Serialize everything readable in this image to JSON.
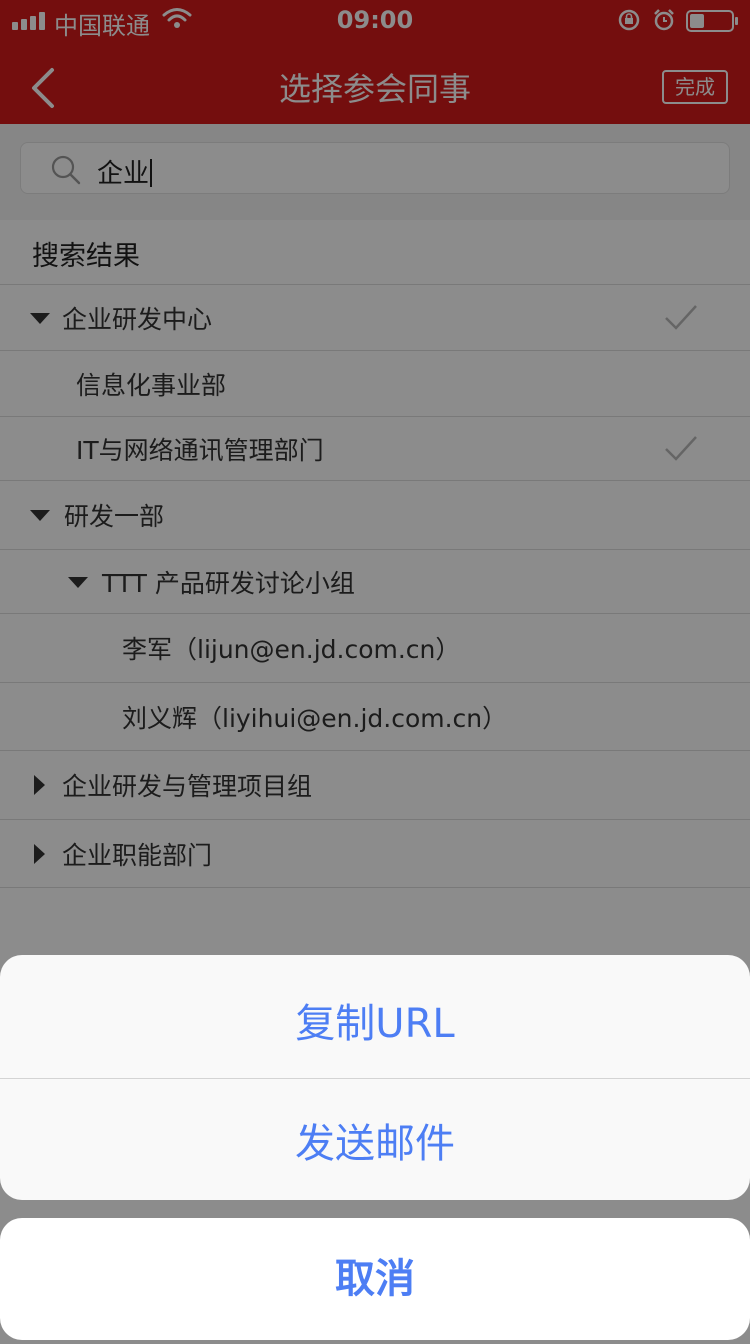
{
  "status_bar": {
    "carrier": "中国联通",
    "time": "09:00"
  },
  "nav": {
    "title": "选择参会同事",
    "done_label": "完成"
  },
  "search": {
    "value": "企业"
  },
  "section_title": "搜索结果",
  "list": [
    {
      "label": "企业研发中心",
      "expanded": true,
      "checked": true
    },
    {
      "label": "信息化事业部",
      "checked": false
    },
    {
      "label": "IT与网络通讯管理部门",
      "checked": true
    },
    {
      "label": "研发一部",
      "expanded": true
    },
    {
      "label": "TTT 产品研发讨论小组",
      "expanded": true
    },
    {
      "label": "李军（lijun@en.jd.com.cn）"
    },
    {
      "label": "刘义辉（liyihui@en.jd.com.cn）"
    },
    {
      "label": "企业研发与管理项目组",
      "expanded": false
    },
    {
      "label": "企业职能部门",
      "expanded": false
    }
  ],
  "action_sheet": {
    "copy_url_label": "复制URL",
    "send_email_label": "发送邮件",
    "cancel_label": "取消"
  },
  "colors": {
    "nav_bar": "#d31b1b",
    "action_text": "#4d7ef4"
  }
}
